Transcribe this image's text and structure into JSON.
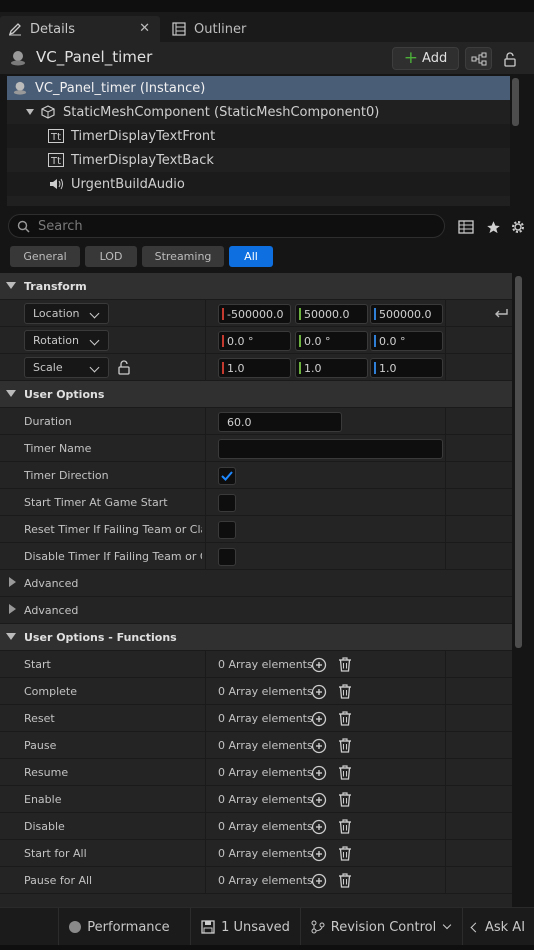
{
  "tabs": [
    {
      "label": "Details",
      "active": true,
      "icon": "pencil-icon"
    },
    {
      "label": "Outliner",
      "active": false,
      "icon": "outliner-icon"
    }
  ],
  "header": {
    "title": "VC_Panel_timer",
    "add_label": "Add"
  },
  "tree": [
    {
      "label": "VC_Panel_timer (Instance)",
      "icon": "actor-icon",
      "selected": true
    },
    {
      "label": "StaticMeshComponent (StaticMeshComponent0)",
      "icon": "mesh-icon"
    },
    {
      "label": "TimerDisplayTextFront",
      "icon": "text-render-icon"
    },
    {
      "label": "TimerDisplayTextBack",
      "icon": "text-render-icon"
    },
    {
      "label": "UrgentBuildAudio",
      "icon": "audio-icon"
    }
  ],
  "search": {
    "placeholder": "Search"
  },
  "filters": [
    "General",
    "LOD",
    "Streaming",
    "All"
  ],
  "active_filter": "All",
  "transform": {
    "category": "Transform",
    "location": {
      "label": "Location",
      "x": "-500000.0",
      "y": "50000.0",
      "z": "500000.0"
    },
    "rotation": {
      "label": "Rotation",
      "x": "0.0 °",
      "y": "0.0 °",
      "z": "0.0 °"
    },
    "scale": {
      "label": "Scale",
      "x": "1.0",
      "y": "1.0",
      "z": "1.0"
    }
  },
  "user_options": {
    "category": "User Options",
    "duration": {
      "label": "Duration",
      "value": "60.0"
    },
    "timer_name": {
      "label": "Timer Name",
      "value": ""
    },
    "timer_direction": {
      "label": "Timer Direction",
      "checked": true
    },
    "start_at_game_start": {
      "label": "Start Timer At Game Start",
      "checked": false
    },
    "reset_if_failing": {
      "label": "Reset Timer If Failing Team or Cla...",
      "checked": false
    },
    "disable_if_failing": {
      "label": "Disable Timer If Failing Team or C...",
      "checked": false
    },
    "advanced_1": "Advanced",
    "advanced_2": "Advanced"
  },
  "functions": {
    "category": "User Options - Functions",
    "array_text": "0 Array elements",
    "items": [
      "Start",
      "Complete",
      "Reset",
      "Pause",
      "Resume",
      "Enable",
      "Disable",
      "Start for All",
      "Pause for All"
    ]
  },
  "statusbar": {
    "performance": "Performance",
    "unsaved": "1 Unsaved",
    "revision": "Revision Control",
    "ask_ai": "Ask AI"
  },
  "colors": {
    "accent": "#0e6fe0",
    "selection": "#4a5d77",
    "add_green": "#4caf3a",
    "axis_x": "#c43a2e",
    "axis_y": "#6db33f",
    "axis_z": "#2f7fd6"
  }
}
